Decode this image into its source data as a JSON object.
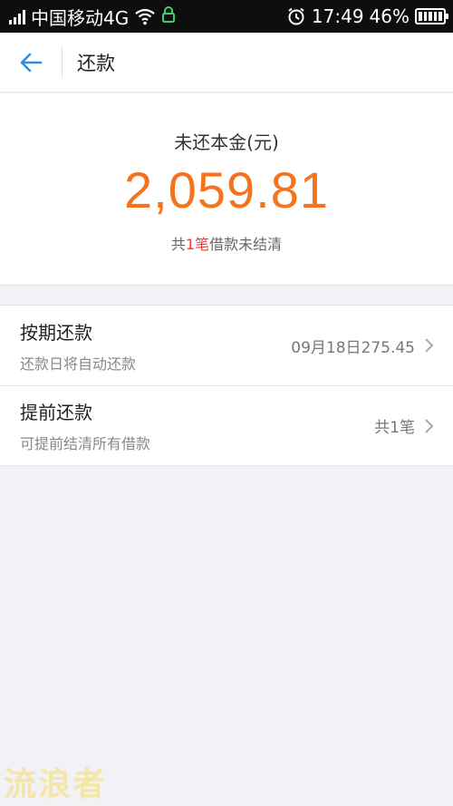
{
  "status_bar": {
    "carrier": "中国移动4G",
    "time": "17:49",
    "battery": "46%"
  },
  "header": {
    "title": "还款",
    "back_icon": "back-arrow-icon"
  },
  "summary": {
    "label": "未还本金(元)",
    "amount": "2,059.81",
    "count_prefix": "共",
    "count_number": "1笔",
    "count_suffix": "借款未结清"
  },
  "options": [
    {
      "title": "按期还款",
      "subtitle": "还款日将自动还款",
      "value": "09月18日275.45"
    },
    {
      "title": "提前还款",
      "subtitle": "可提前结清所有借款",
      "value": "共1笔"
    }
  ],
  "watermark": "流浪者",
  "colors": {
    "accent": "#f5731c",
    "highlight": "#e83b3b",
    "back_arrow": "#2d8fe2",
    "background": "#f2f2f6"
  }
}
